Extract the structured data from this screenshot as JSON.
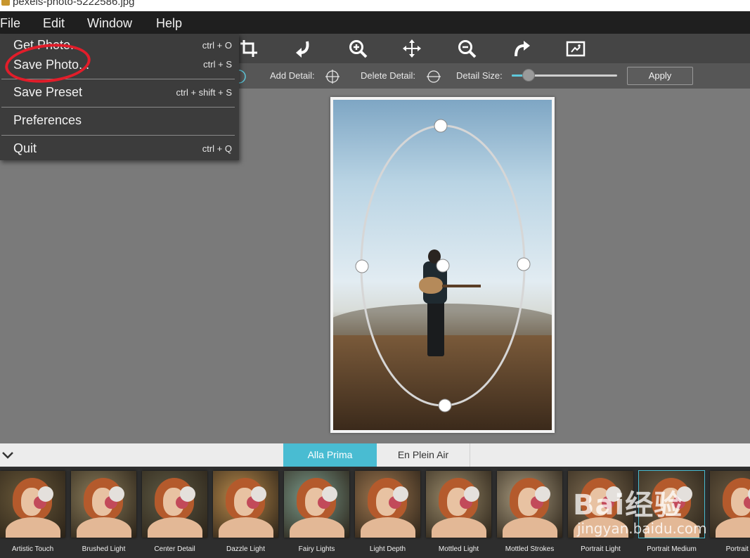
{
  "window": {
    "title": "pexels-photo-5222586.jpg"
  },
  "menubar": {
    "items": [
      "File",
      "Edit",
      "Window",
      "Help"
    ]
  },
  "file_menu": {
    "items": [
      {
        "label": "Get Photo...",
        "shortcut": "ctrl + O"
      },
      {
        "label": "Save Photo...",
        "shortcut": "ctrl + S"
      },
      {
        "label": "Save Preset",
        "shortcut": "ctrl + shift + S"
      },
      {
        "label": "Preferences",
        "shortcut": ""
      },
      {
        "label": "Quit",
        "shortcut": "ctrl + Q"
      }
    ]
  },
  "toolbar": {
    "tools": [
      "crop-icon",
      "rotate-left-icon",
      "zoom-in-icon",
      "move-icon",
      "zoom-out-icon",
      "redo-icon",
      "fit-image-icon"
    ]
  },
  "options": {
    "add_detail_label": "Add Detail:",
    "delete_detail_label": "Delete Detail:",
    "detail_size_label": "Detail Size:",
    "detail_size_value": 0.16,
    "apply_label": "Apply"
  },
  "style_tabs": {
    "active": "Alla Prima",
    "items": [
      "Alla Prima",
      "En Plein Air"
    ]
  },
  "presets": [
    {
      "label": "Artistic Touch",
      "tint": "#6b5a3a"
    },
    {
      "label": "Brushed Light",
      "tint": "#8a7c5a"
    },
    {
      "label": "Center Detail",
      "tint": "#5e5a44"
    },
    {
      "label": "Dazzle Light",
      "tint": "#b8894a"
    },
    {
      "label": "Fairy Lights",
      "tint": "#7a9a8a"
    },
    {
      "label": "Light Depth",
      "tint": "#a07850"
    },
    {
      "label": "Mottled Light",
      "tint": "#9a8a6a"
    },
    {
      "label": "Mottled Strokes",
      "tint": "#a89a7e"
    },
    {
      "label": "Portrait Light",
      "tint": "#7c6a50"
    },
    {
      "label": "Portrait Medium",
      "tint": "#6e6048",
      "selected": true
    },
    {
      "label": "Portrait Na",
      "tint": "#6a5a42"
    }
  ],
  "watermark": {
    "text": "Bai经验",
    "sub": "jingyan.baidu.com"
  },
  "colors": {
    "accent": "#49bcd2",
    "annotation": "#e21d2a"
  }
}
